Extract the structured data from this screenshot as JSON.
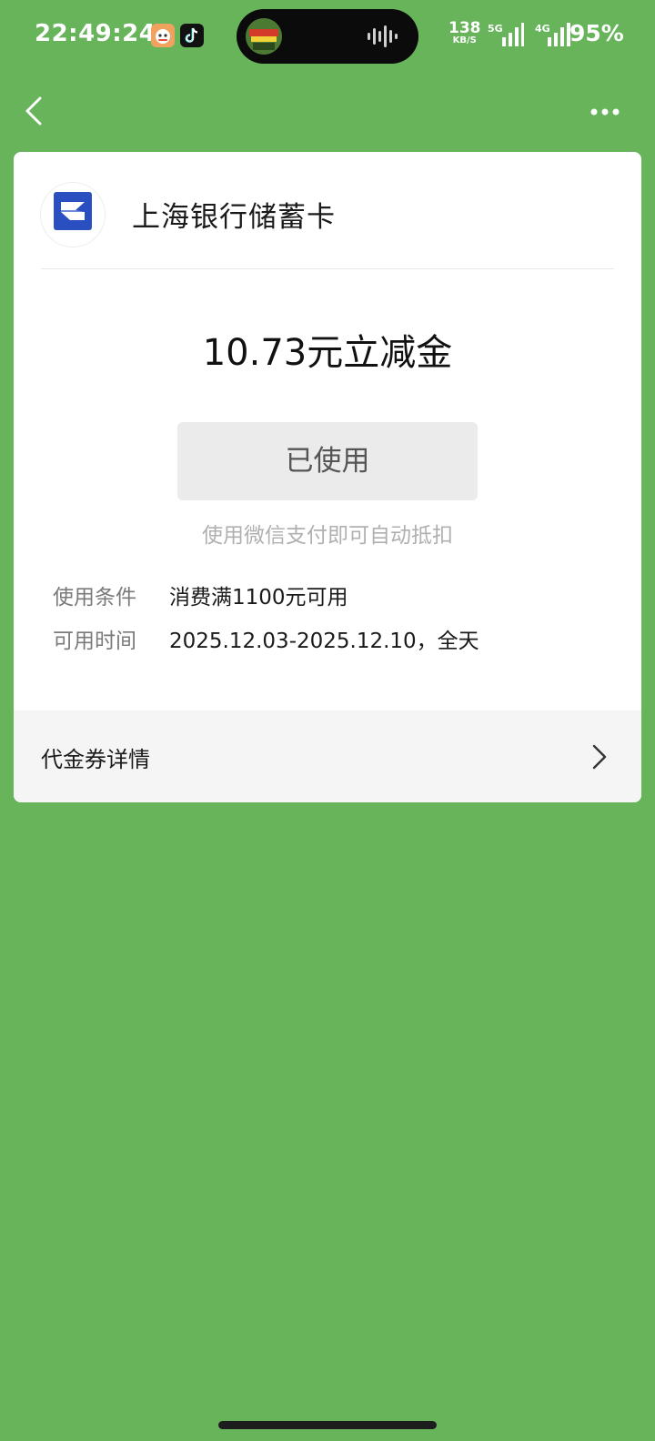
{
  "status_bar": {
    "time": "22:49:24",
    "net_speed_value": "138",
    "net_speed_unit": "KB/S",
    "signal_1": "5G",
    "signal_2": "4G",
    "battery": "95%"
  },
  "nav": {
    "back_icon": "chevron-left-icon",
    "more_icon": "more-dots-icon"
  },
  "coupon": {
    "merchant_name": "上海银行储蓄卡",
    "amount_title": "10.73元立减金",
    "status_button": "已使用",
    "hint": "使用微信支付即可自动抵扣",
    "conditions": [
      {
        "label": "使用条件",
        "value": "消费满1100元可用"
      },
      {
        "label": "可用时间",
        "value": "2025.12.03-2025.12.10，全天"
      }
    ],
    "details_link": "代金券详情"
  },
  "colors": {
    "background": "#67b45b",
    "card": "#ffffff",
    "brand_blue": "#2a4fc1"
  }
}
